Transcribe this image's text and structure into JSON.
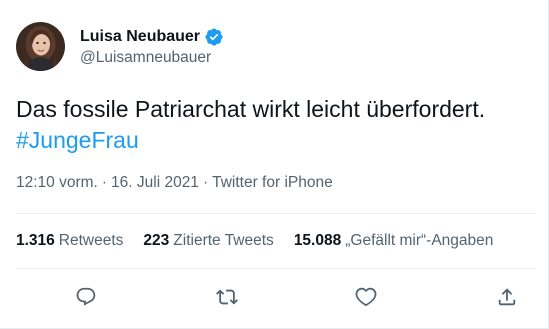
{
  "user": {
    "display_name": "Luisa Neubauer",
    "handle": "@Luisamneubauer",
    "verified_icon": "verified-badge-icon",
    "avatar_icon": "profile-photo"
  },
  "tweet": {
    "text": "Das fossile Patriarchat wirkt leicht überfordert.",
    "hashtag": "#JungeFrau"
  },
  "meta": {
    "time": "12:10 vorm.",
    "separator": "·",
    "date": "16. Juli 2021",
    "source": "Twitter for iPhone"
  },
  "stats": {
    "retweets_count": "1.316",
    "retweets_label": "Retweets",
    "quotes_count": "223",
    "quotes_label": "Zitierte Tweets",
    "likes_count": "15.088",
    "likes_label": "„Gefällt mir“-Angaben"
  },
  "actions": [
    "reply-icon",
    "retweet-icon",
    "like-icon",
    "share-icon"
  ],
  "colors": {
    "link": "#1d9bf0",
    "verified": "#1d9bf0",
    "secondary_text": "#536471",
    "divider": "#e6ecf0"
  }
}
